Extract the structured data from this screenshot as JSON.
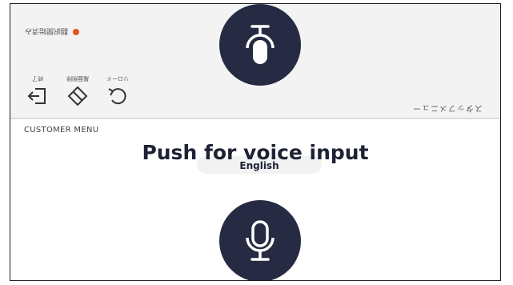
{
  "staff_panel": {
    "status_text": "翻訳開始済み",
    "language_label": "スタッフメニュー",
    "tools": {
      "exit_label": "終了",
      "clear_label": "履歴削除",
      "reload_label": "リロード"
    }
  },
  "customer_panel": {
    "menu_label": "CUSTOMER MENU",
    "push_label": "Push for voice input",
    "language": "English"
  },
  "colors": {
    "mic_background": "#262b43",
    "status_dot": "#e5531d",
    "text_dark": "#1e2235"
  },
  "icons": [
    "microphone-icon",
    "exit-icon",
    "eraser-icon",
    "reload-icon"
  ]
}
